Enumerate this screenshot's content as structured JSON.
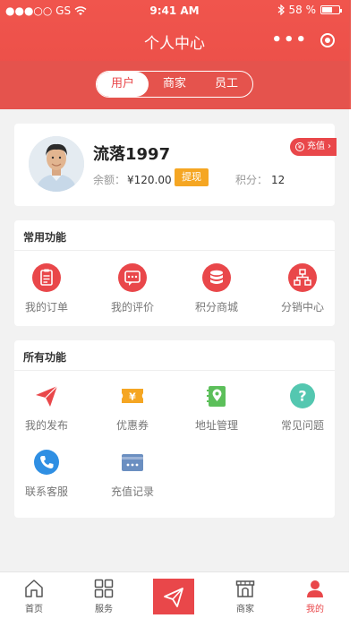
{
  "status_bar": {
    "carrier": "●●●○○ GS",
    "time": "9:41 AM",
    "battery": "58 %"
  },
  "nav": {
    "title": "个人中心",
    "more": "•••"
  },
  "segments": [
    {
      "label": "用户",
      "active": true
    },
    {
      "label": "商家",
      "active": false
    },
    {
      "label": "员工",
      "active": false
    }
  ],
  "profile": {
    "username": "流落1997",
    "balance_label": "余额：",
    "balance_value": "¥120.00",
    "withdraw_label": "提现",
    "points_label": "积分：",
    "points_value": "12",
    "recharge_label": "充值",
    "recharge_arrow": "›"
  },
  "common_functions": {
    "title": "常用功能",
    "items": [
      {
        "label": "我的订单",
        "icon": "order-icon"
      },
      {
        "label": "我的评价",
        "icon": "review-icon"
      },
      {
        "label": "积分商城",
        "icon": "points-mall-icon"
      },
      {
        "label": "分销中心",
        "icon": "distribution-icon"
      }
    ]
  },
  "all_functions": {
    "title": "所有功能",
    "items": [
      {
        "label": "我的发布",
        "icon": "paper-plane-icon"
      },
      {
        "label": "优惠券",
        "icon": "coupon-icon"
      },
      {
        "label": "地址管理",
        "icon": "location-book-icon"
      },
      {
        "label": "常见问题",
        "icon": "question-icon"
      },
      {
        "label": "联系客服",
        "icon": "phone-icon"
      },
      {
        "label": "充值记录",
        "icon": "card-icon"
      }
    ]
  },
  "tabbar": {
    "items": [
      {
        "label": "首页",
        "icon": "home-icon",
        "active": false
      },
      {
        "label": "服务",
        "icon": "grid-icon",
        "active": false
      },
      {
        "label": "",
        "icon": "send-icon",
        "active": false
      },
      {
        "label": "商家",
        "icon": "shop-icon",
        "active": false
      },
      {
        "label": "我的",
        "icon": "user-icon",
        "active": true
      }
    ]
  },
  "colors": {
    "brand_red": "#e9474a",
    "coupon_orange": "#f5a623",
    "location_green": "#5cbf5a",
    "question_teal": "#54c7b0",
    "phone_blue": "#2f8fe3",
    "card_blue": "#6b8fc1"
  }
}
